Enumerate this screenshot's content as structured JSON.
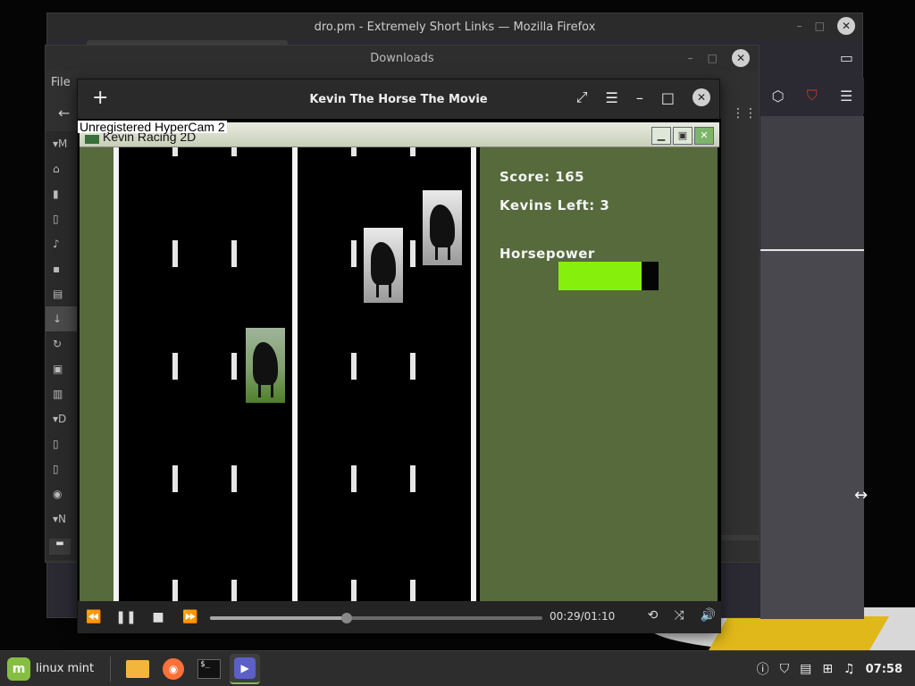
{
  "firefox": {
    "title": "dro.pm - Extremely Short Links — Mozilla Firefox",
    "minimize_icon": "minimize-icon",
    "close_label": "✕"
  },
  "downloads": {
    "title": "Downloads",
    "menu_file": "File",
    "sidebar_section_letters": [
      "M",
      "D",
      "N"
    ],
    "close_label": "✕"
  },
  "player": {
    "title": "Kevin The Horse The Movie",
    "add_label": "+",
    "close_label": "✕",
    "time": "00:29/01:10",
    "progress": 0.41
  },
  "video": {
    "watermark": "Unregistered HyperCam 2",
    "game_window_title": "Kevin Racing 2D",
    "score_label": "Score: 165",
    "kevins_left_label": "Kevins Left: 3",
    "horsepower_label": "Horsepower",
    "horsepower_level": 0.83
  },
  "taskbar": {
    "menu_label": "linux mint",
    "clock": "07:58"
  },
  "colors": {
    "grass": "#566a3b",
    "horsepower_fill": "#86f00c",
    "mint_green": "#86be43"
  }
}
